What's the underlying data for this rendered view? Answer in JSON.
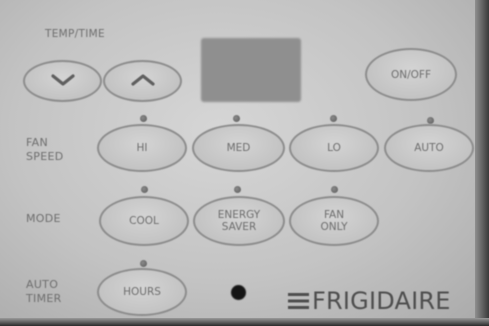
{
  "labels": {
    "temp_time": "TEMP/TIME",
    "fan_speed": "FAN\nSPEED",
    "mode": "MODE",
    "auto_timer": "AUTO\nTIMER"
  },
  "buttons": {
    "down_icon": "chevron-down-icon",
    "up_icon": "chevron-up-icon",
    "on_off": "ON/OFF",
    "hi": "HI",
    "med": "MED",
    "lo": "LO",
    "auto": "AUTO",
    "cool": "COOL",
    "energy_saver": "ENERGY\nSAVER",
    "fan_only": "FAN\nONLY",
    "hours": "HOURS"
  },
  "brand": {
    "name": "FRIGIDAIRE",
    "mark_icon": "frigidaire-logo-icon"
  },
  "colors": {
    "panel": "#c8c8c8",
    "text": "#6e6e6e",
    "display": "#8f8f8f",
    "logo": "#4e4e4e"
  }
}
